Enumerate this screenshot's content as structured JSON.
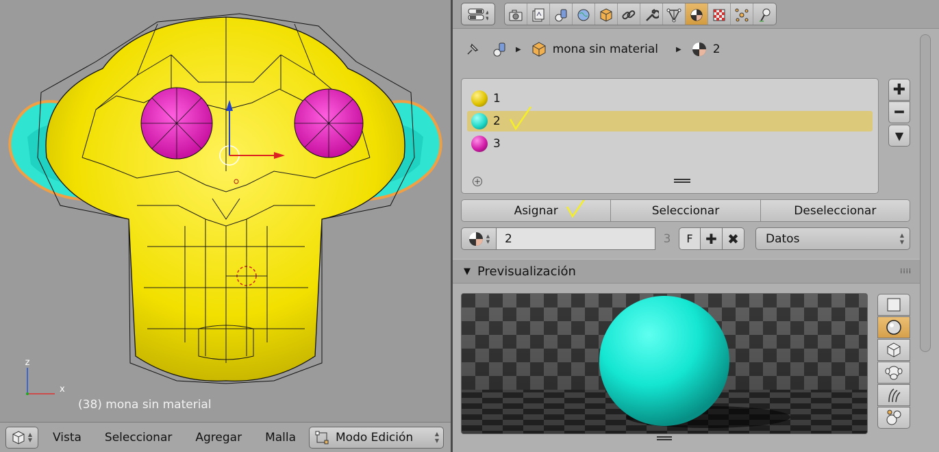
{
  "viewport": {
    "object_info": "(38) mona sin material",
    "axis_x": "x",
    "axis_z": "z"
  },
  "viewport_header": {
    "menus": [
      "Vista",
      "Seleccionar",
      "Agregar",
      "Malla"
    ],
    "mode": "Modo Edición"
  },
  "properties": {
    "context_tabs": [
      "render",
      "render-layers",
      "scene",
      "world",
      "object",
      "constraints",
      "modifiers",
      "data",
      "material",
      "texture",
      "particles",
      "physics"
    ],
    "active_tab": "material",
    "breadcrumb": {
      "object": "mona sin material",
      "material": "2"
    },
    "material_slots": [
      {
        "label": "1",
        "color": "#e0c400"
      },
      {
        "label": "2",
        "color": "#1fd9c8"
      },
      {
        "label": "3",
        "color": "#d21ca8"
      }
    ],
    "selected_slot": "2",
    "buttons": {
      "assign": "Asignar",
      "select": "Seleccionar",
      "deselect": "Deseleccionar"
    },
    "material_name": "2",
    "material_users": "3",
    "fake_user": "F",
    "link": "Datos",
    "preview_panel_title": "Previsualización",
    "preview_color": "#14e6d2"
  },
  "colors": {
    "mesh_yellow": "#f2e000",
    "eyes_magenta": "#e81bbf",
    "ears_cyan": "#23e6d6",
    "selection_orange": "#f5a040",
    "active_tab": "#d39d44",
    "selected_slot_bg": "#dcc97a"
  }
}
